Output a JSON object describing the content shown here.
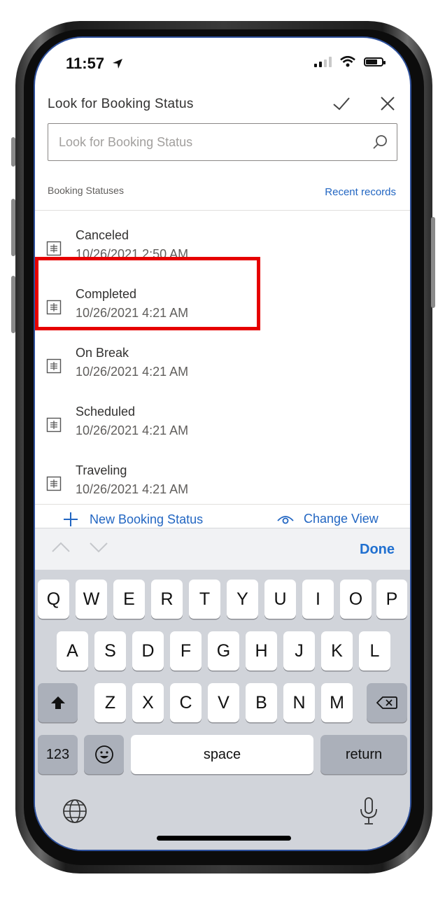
{
  "status_bar": {
    "time": "11:57"
  },
  "header": {
    "title": "Look for Booking Status",
    "confirm_icon": "checkmark-icon",
    "close_icon": "close-icon"
  },
  "search": {
    "placeholder": "Look for Booking Status",
    "value": ""
  },
  "section": {
    "label": "Booking Statuses",
    "recent_link": "Recent records"
  },
  "records": [
    {
      "name": "Canceled",
      "date": "10/26/2021 2:50 AM"
    },
    {
      "name": "Completed",
      "date": "10/26/2021 4:21 AM"
    },
    {
      "name": "On Break",
      "date": "10/26/2021 4:21 AM"
    },
    {
      "name": "Scheduled",
      "date": "10/26/2021 4:21 AM"
    },
    {
      "name": "Traveling",
      "date": "10/26/2021 4:21 AM"
    }
  ],
  "footer": {
    "new_label": "New Booking Status",
    "view_label": "Change View"
  },
  "keyboard": {
    "done_label": "Done",
    "row1": [
      "Q",
      "W",
      "E",
      "R",
      "T",
      "Y",
      "U",
      "I",
      "O",
      "P"
    ],
    "row2": [
      "A",
      "S",
      "D",
      "F",
      "G",
      "H",
      "J",
      "K",
      "L"
    ],
    "row3": [
      "Z",
      "X",
      "C",
      "V",
      "B",
      "N",
      "M"
    ],
    "numbers_label": "123",
    "space_label": "space",
    "return_label": "return"
  },
  "colors": {
    "accent": "#2266c2",
    "highlight": "#e60000",
    "frame_edge": "#2d4f9a"
  }
}
